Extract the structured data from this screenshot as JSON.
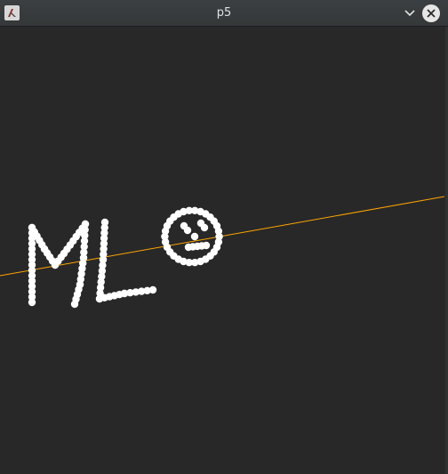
{
  "window": {
    "title": "p5",
    "app_icon": "processing-app-icon",
    "controls": {
      "minimize_icon": "chevron-down-icon",
      "close_icon": "close-icon"
    }
  },
  "canvas": {
    "background_color": "#282828",
    "point_color": "#ffffff",
    "line_color": "#ffa500",
    "drawing_content": "ML☺"
  }
}
